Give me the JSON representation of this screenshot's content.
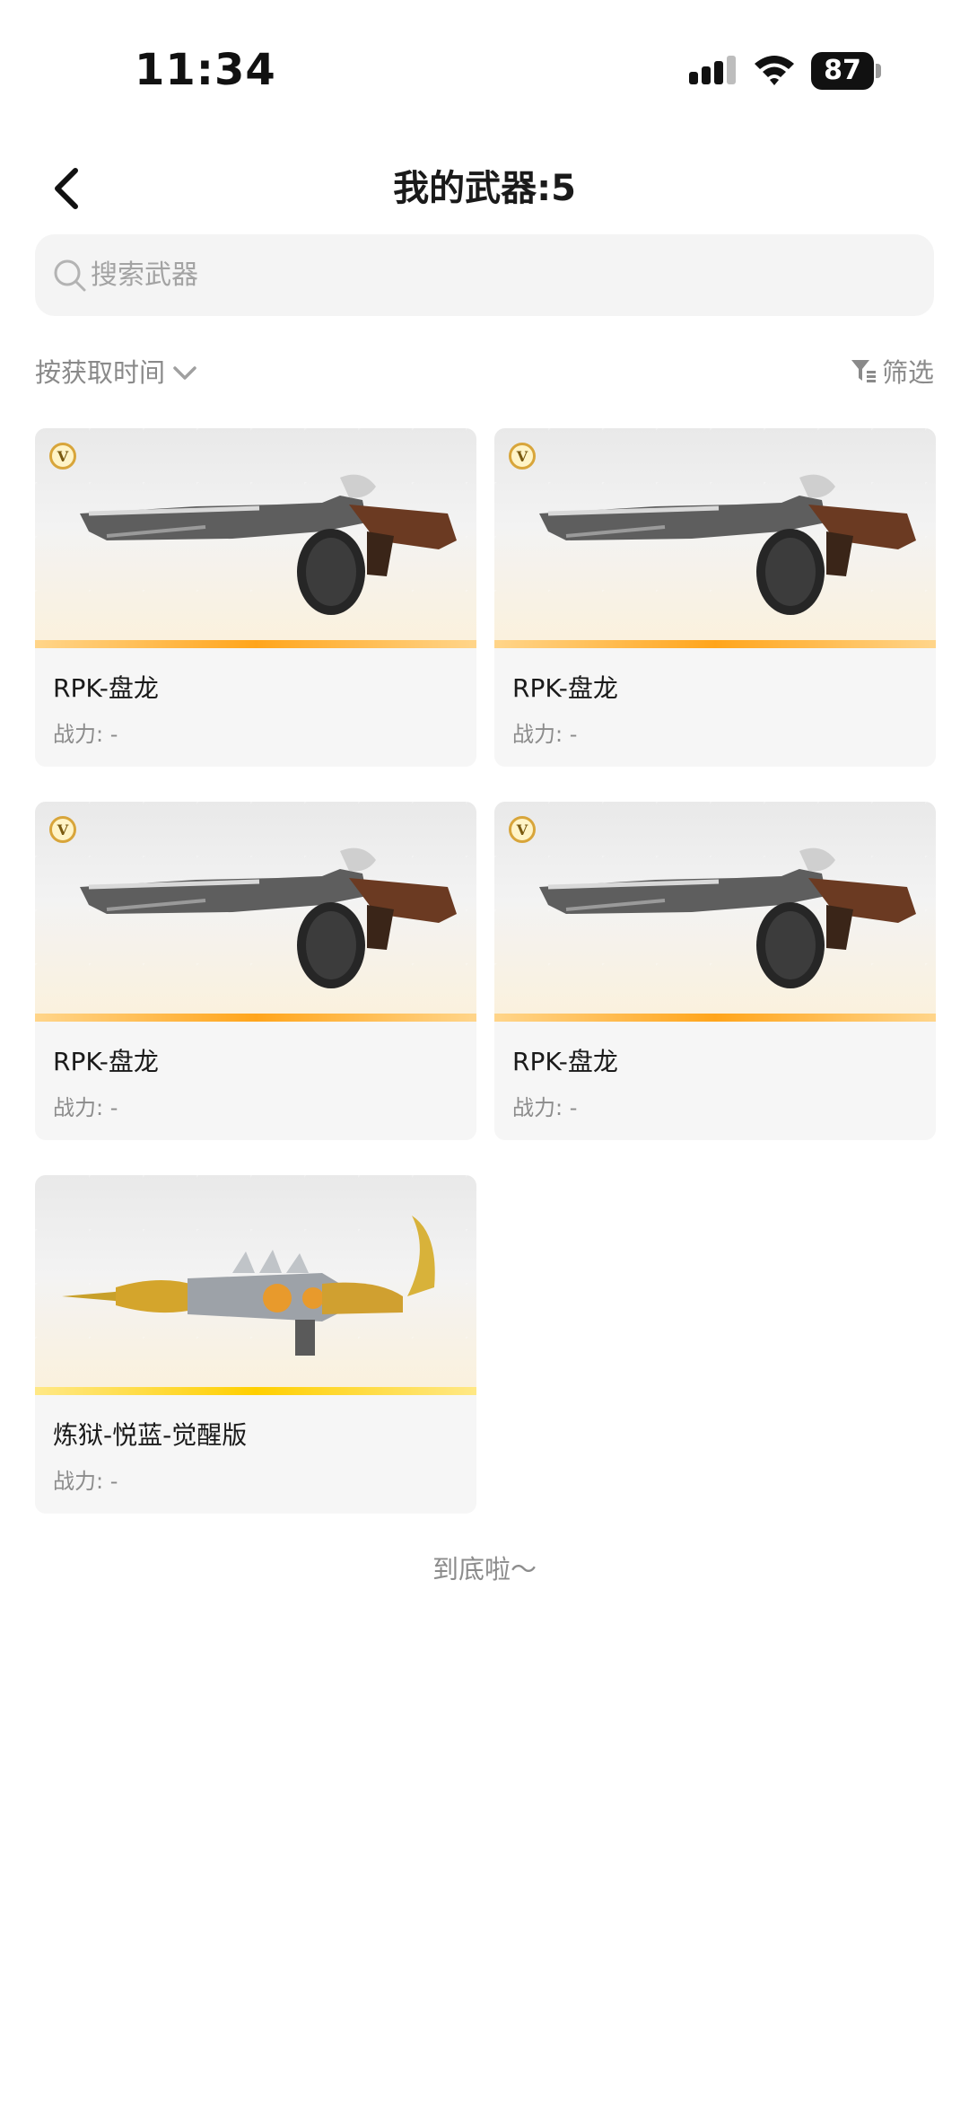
{
  "status_bar": {
    "time": "11:34",
    "battery": "87",
    "icons": [
      "signal-icon",
      "wifi-icon",
      "battery-icon"
    ]
  },
  "header": {
    "title": "我的武器:5",
    "back_icon": "chevron-left-icon"
  },
  "search": {
    "placeholder": "搜索武器",
    "value": ""
  },
  "sort": {
    "label": "按获取时间",
    "icon": "chevron-down-icon"
  },
  "filter": {
    "label": "筛选",
    "icon": "filter-icon"
  },
  "weapons": [
    {
      "name": "RPK-盘龙",
      "power": "战力: -",
      "badge": "V"
    },
    {
      "name": "RPK-盘龙",
      "power": "战力: -",
      "badge": "V"
    },
    {
      "name": "RPK-盘龙",
      "power": "战力: -",
      "badge": "V"
    },
    {
      "name": "RPK-盘龙",
      "power": "战力: -",
      "badge": "V"
    },
    {
      "name": "炼狱-悦蓝-觉醒版",
      "power": "战力: -",
      "badge": ""
    }
  ],
  "footer": {
    "end_text": "到底啦～"
  },
  "colors": {
    "accent_orange": "#ffa51c",
    "accent_gold": "#ffcf00",
    "muted_text": "#8c8c8c",
    "card_bg": "#f6f6f6"
  }
}
